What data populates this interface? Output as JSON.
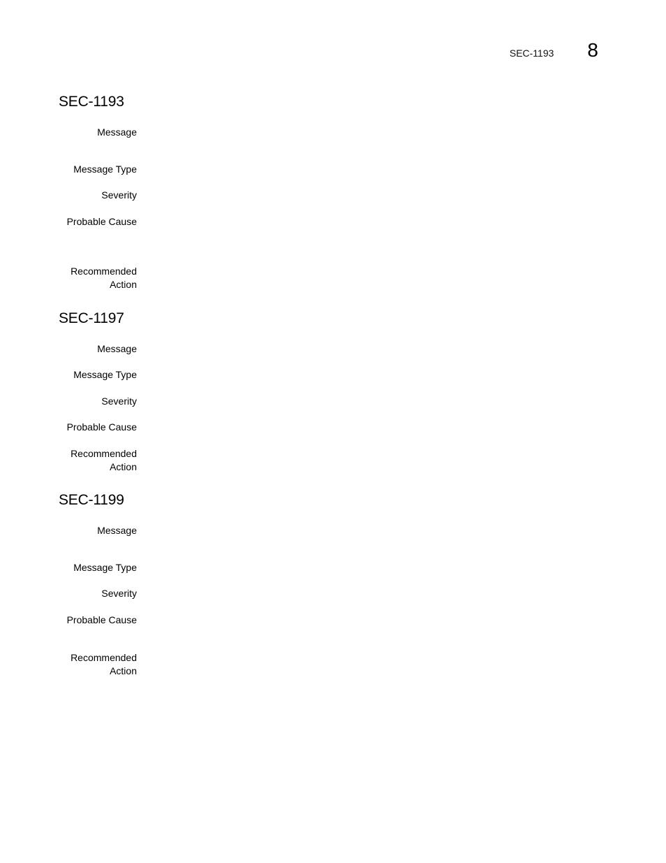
{
  "header": {
    "running_title": "SEC-1193",
    "chapter_number": "8"
  },
  "entries": [
    {
      "id": "SEC-1193",
      "labels": {
        "message": "Message",
        "message_type": "Message Type",
        "severity": "Severity",
        "probable_cause": "Probable Cause",
        "recommended_action_1": "Recommended",
        "recommended_action_2": "Action"
      }
    },
    {
      "id": "SEC-1197",
      "labels": {
        "message": "Message",
        "message_type": "Message Type",
        "severity": "Severity",
        "probable_cause": "Probable Cause",
        "recommended_action_1": "Recommended",
        "recommended_action_2": "Action"
      }
    },
    {
      "id": "SEC-1199",
      "labels": {
        "message": "Message",
        "message_type": "Message Type",
        "severity": "Severity",
        "probable_cause": "Probable Cause",
        "recommended_action_1": "Recommended",
        "recommended_action_2": "Action"
      }
    }
  ]
}
